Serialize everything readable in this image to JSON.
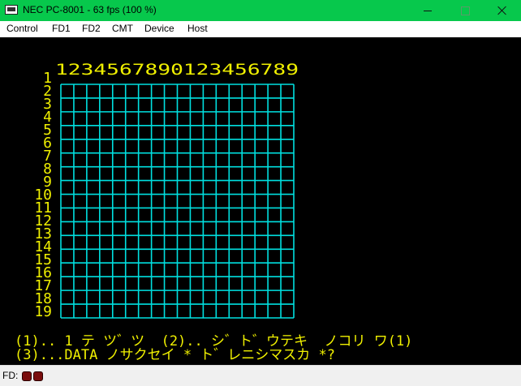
{
  "window": {
    "title": "NEC PC-8001 - 63 fps (100 %)",
    "icon": "pc-app-icon",
    "controls": [
      "minimize-icon",
      "maximize-icon",
      "close-icon"
    ]
  },
  "menu": [
    "Control",
    "FD1",
    "FD2",
    "CMT",
    "Device",
    "Host"
  ],
  "screen": {
    "text_color": "#f0f000",
    "grid_color": "#00e0e0",
    "background": "#000000",
    "column_header": "1234567890123456789",
    "row_labels": [
      "1",
      "2",
      "3",
      "4",
      "5",
      "6",
      "7",
      "8",
      "9",
      "10",
      "11",
      "12",
      "13",
      "14",
      "15",
      "16",
      "17",
      "18",
      "19"
    ],
    "grid_columns": 18,
    "grid_rows": 17,
    "line1": "(1).. 1 テ ツ゛ツ  (2).. シ゛ト゛ウテキ  ノコリ ワ(1)",
    "line2": "(3)...DATA ノサクセイ * ト゛レニシマスカ *?"
  },
  "status": {
    "label": "FD:",
    "leds": [
      "fd1-led",
      "fd2-led"
    ]
  }
}
